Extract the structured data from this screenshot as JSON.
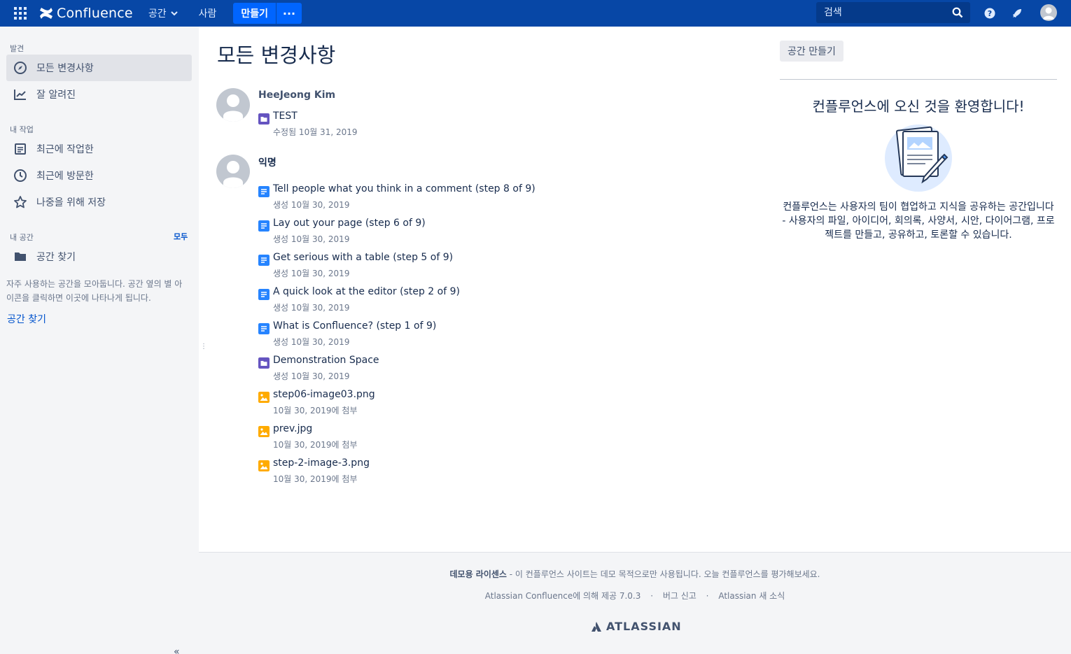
{
  "colors": {
    "topbar": "#0747a6",
    "create_button": "#0065ff",
    "sidebar_bg": "#f4f5f7",
    "page_icon": "#2684ff",
    "space_icon": "#6554c0",
    "image_icon": "#ffab00",
    "link": "#0052cc"
  },
  "topbar": {
    "app_name": "Confluence",
    "nav_spaces": "공간",
    "nav_people": "사람",
    "create_label": "만들기",
    "more_label": "···",
    "search_placeholder": "검색"
  },
  "sidebar": {
    "discover_heading": "발견",
    "items_discover": [
      {
        "label": "모든 변경사항",
        "icon": "compass-icon"
      },
      {
        "label": "잘 알려진",
        "icon": "trending-icon"
      }
    ],
    "mywork_heading": "내 작업",
    "items_mywork": [
      {
        "label": "최근에 작업한",
        "icon": "document-icon"
      },
      {
        "label": "최근에 방문한",
        "icon": "clock-icon"
      },
      {
        "label": "나중을 위해 저장",
        "icon": "star-icon"
      }
    ],
    "myspaces_heading": "내 공간",
    "all_link": "모두",
    "find_space_item": "공간 찾기",
    "note": "자주 사용하는 공간을 모아둡니다. 공간 옆의 별 아이콘을 클릭하면 이곳에 나타나게 됩니다.",
    "find_space_link": "공간 찾기",
    "collapse": "«"
  },
  "main": {
    "title": "모든 변경사항",
    "groups": [
      {
        "user": "HeeJeong Kim",
        "entries": [
          {
            "title": "TEST",
            "meta": "수정됨 10월 31, 2019",
            "type": "space"
          }
        ]
      },
      {
        "user": "익명",
        "entries": [
          {
            "title": "Tell people what you think in a comment (step 8 of 9)",
            "meta": "생성 10월 30, 2019",
            "type": "page"
          },
          {
            "title": "Lay out your page (step 6 of 9)",
            "meta": "생성 10월 30, 2019",
            "type": "page"
          },
          {
            "title": "Get serious with a table (step 5 of 9)",
            "meta": "생성 10월 30, 2019",
            "type": "page"
          },
          {
            "title": "A quick look at the editor (step 2 of 9)",
            "meta": "생성 10월 30, 2019",
            "type": "page"
          },
          {
            "title": "What is Confluence? (step 1 of 9)",
            "meta": "생성 10월 30, 2019",
            "type": "page"
          },
          {
            "title": "Demonstration Space",
            "meta": "생성 10월 30, 2019",
            "type": "space"
          },
          {
            "title": "step06-image03.png",
            "meta": "10월 30, 2019에 첨부",
            "type": "image"
          },
          {
            "title": "prev.jpg",
            "meta": "10월 30, 2019에 첨부",
            "type": "image"
          },
          {
            "title": "step-2-image-3.png",
            "meta": "10월 30, 2019에 첨부",
            "type": "image"
          }
        ]
      }
    ]
  },
  "right": {
    "create_space_button": "공간 만들기",
    "welcome_title": "컨플루언스에 오신 것을 환영합니다!",
    "welcome_text": "컨플루언스는 사용자의 팀이 협업하고 지식을 공유하는 공간입니다 - 사용자의 파일, 아이디어, 회의록, 사양서, 시안, 다이어그램, 프로젝트를 만들고, 공유하고, 토론할 수 있습니다."
  },
  "footer": {
    "license_bold": "데모용 라이센스",
    "license_text": " - 이 컨플루언스 사이트는 데모 목적으로만 사용됩니다. 오늘 컨플루언스를 평가해보세요.",
    "powered_by": "Atlassian Confluence에 의해 제공 7.0.3",
    "report_bug": "버그 신고",
    "news": "Atlassian 새 소식",
    "separator": "·",
    "brand": "ATLASSIAN"
  }
}
